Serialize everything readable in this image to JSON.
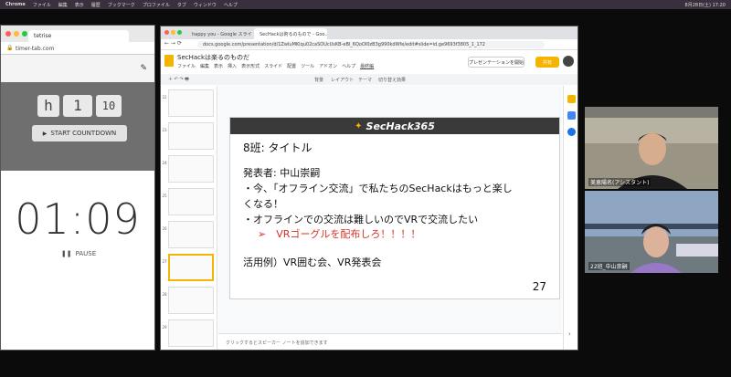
{
  "macbar": {
    "app": "Chrome",
    "items": [
      "ファイル",
      "編集",
      "表示",
      "履歴",
      "ブックマーク",
      "プロファイル",
      "タブ",
      "ウィンドウ",
      "ヘルプ"
    ],
    "clock": "8月28日(土) 17:20"
  },
  "timer_window": {
    "tab_title": "tetrise",
    "url": "timer-tab.com",
    "set_hours": "h",
    "set_minutes": "1",
    "set_seconds": "10",
    "start_label": "START COUNTDOWN",
    "countdown": "01:09",
    "pause_label": "PAUSE"
  },
  "slides_window": {
    "tabs": [
      "happy you - Google スライド",
      "SecHackは術るのもので - Goo..."
    ],
    "url": "docs.google.com/presentation/d/1ZwIuMKlqu02caSOUcUsKB-eBl_6QoOI0zB3g990kdWfe/edit#slide=id.ge9693f3805_1_172",
    "doc_title": "SecHackは楽るのものだ",
    "menus": [
      "ファイル",
      "編集",
      "表示",
      "挿入",
      "表示形式",
      "スライド",
      "配置",
      "ツール",
      "アドオン",
      "ヘルプ",
      "最終編"
    ],
    "present_label": "プレゼンテーションを開始",
    "share_label": "共有",
    "toolbar_items": [
      "背景",
      "レイアウト",
      "テーマ",
      "切り替え効果"
    ],
    "thumb_numbers": [
      "22",
      "23",
      "24",
      "25",
      "26",
      "27",
      "28",
      "29"
    ],
    "notes_placeholder": "クリックするとスピーカー ノートを追加できます"
  },
  "slide": {
    "logo_text": "SecHack365",
    "title": "8班: タイトル",
    "lines": [
      "発表者: 中山崇嗣",
      "・今、「オフライン交流」で私たちのSecHackはもっと楽し",
      "くなる！",
      "・オフラインでの交流は難しいのでVRで交流したい",
      "➢　VRゴーグルを配布しろ！！！！",
      "活用例）VR囲む会、VR発表会"
    ],
    "page_number": "27"
  },
  "participants": [
    {
      "name": "美恵陽名(アシスタント)"
    },
    {
      "name": "22班_中山崇嗣"
    }
  ],
  "colors": {
    "accent": "#f4b400",
    "red": "#d93025",
    "dark_header": "#3a3a3a"
  }
}
